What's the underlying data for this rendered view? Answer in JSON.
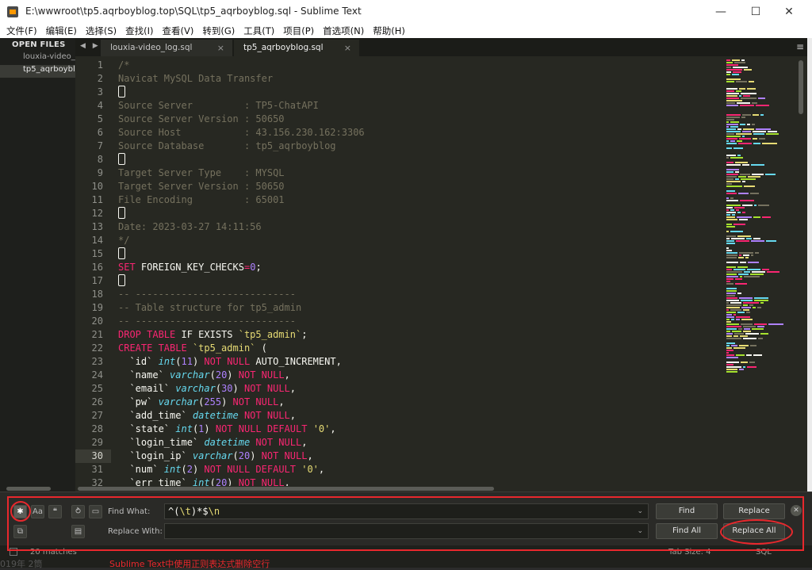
{
  "window": {
    "title": "E:\\wwwroot\\tp5.aqrboyblog.top\\SQL\\tp5_aqrboyblog.sql - Sublime Text",
    "minimize": "—",
    "maximize": "☐",
    "close": "✕"
  },
  "menu": [
    "文件(F)",
    "编辑(E)",
    "选择(S)",
    "查找(I)",
    "查看(V)",
    "转到(G)",
    "工具(T)",
    "项目(P)",
    "首选项(N)",
    "帮助(H)"
  ],
  "sidebar": {
    "header": "OPEN FILES",
    "files": [
      {
        "label": "louxia-video_"
      },
      {
        "label": "tp5_aqrboybl"
      }
    ]
  },
  "tabs": {
    "arrows": "◀ ▶",
    "items": [
      {
        "label": "louxia-video_log.sql",
        "close": "×"
      },
      {
        "label": "tp5_aqrboyblog.sql",
        "close": "×"
      }
    ],
    "menu": "≡"
  },
  "editor": {
    "current_line": 30,
    "lines": [
      {
        "n": "1",
        "segs": [
          {
            "t": "/*",
            "c": "cmt"
          }
        ]
      },
      {
        "n": "2",
        "segs": [
          {
            "t": "Navicat MySQL Data Transfer",
            "c": "cmt"
          }
        ]
      },
      {
        "n": "3",
        "segs": [],
        "blank": true
      },
      {
        "n": "4",
        "segs": [
          {
            "t": "Source Server         : TP5-ChatAPI",
            "c": "cmt"
          }
        ]
      },
      {
        "n": "5",
        "segs": [
          {
            "t": "Source Server Version : 50650",
            "c": "cmt"
          }
        ]
      },
      {
        "n": "6",
        "segs": [
          {
            "t": "Source Host           : 43.156.230.162:3306",
            "c": "cmt"
          }
        ]
      },
      {
        "n": "7",
        "segs": [
          {
            "t": "Source Database       : tp5_aqrboyblog",
            "c": "cmt"
          }
        ]
      },
      {
        "n": "8",
        "segs": [],
        "blank": true
      },
      {
        "n": "9",
        "segs": [
          {
            "t": "Target Server Type    : MYSQL",
            "c": "cmt"
          }
        ]
      },
      {
        "n": "10",
        "segs": [
          {
            "t": "Target Server Version : 50650",
            "c": "cmt"
          }
        ]
      },
      {
        "n": "11",
        "segs": [
          {
            "t": "File Encoding         : 65001",
            "c": "cmt"
          }
        ]
      },
      {
        "n": "12",
        "segs": [],
        "blank": true
      },
      {
        "n": "13",
        "segs": [
          {
            "t": "Date: 2023-03-27 14:11:56",
            "c": "cmt"
          }
        ]
      },
      {
        "n": "14",
        "segs": [
          {
            "t": "*/",
            "c": "cmt"
          }
        ]
      },
      {
        "n": "15",
        "segs": [],
        "blank": true
      },
      {
        "n": "16",
        "segs": [
          {
            "t": "SET",
            "c": "kw"
          },
          {
            "t": " FOREIGN_KEY_CHECKS",
            "c": ""
          },
          {
            "t": "=",
            "c": "kw"
          },
          {
            "t": "0",
            "c": "num"
          },
          {
            "t": ";",
            "c": ""
          }
        ]
      },
      {
        "n": "17",
        "segs": [],
        "blank": true
      },
      {
        "n": "18",
        "segs": [
          {
            "t": "-- ----------------------------",
            "c": "cmt"
          }
        ]
      },
      {
        "n": "19",
        "segs": [
          {
            "t": "-- Table structure for tp5_admin",
            "c": "cmt"
          }
        ]
      },
      {
        "n": "20",
        "segs": [
          {
            "t": "-- ----------------------------",
            "c": "cmt"
          }
        ]
      },
      {
        "n": "21",
        "segs": [
          {
            "t": "DROP TABLE",
            "c": "kw"
          },
          {
            "t": " IF EXISTS ",
            "c": ""
          },
          {
            "t": "`tp5_admin`",
            "c": "str"
          },
          {
            "t": ";",
            "c": ""
          }
        ]
      },
      {
        "n": "22",
        "segs": [
          {
            "t": "CREATE TABLE",
            "c": "kw"
          },
          {
            "t": " ",
            "c": ""
          },
          {
            "t": "`tp5_admin`",
            "c": "str"
          },
          {
            "t": " (",
            "c": ""
          }
        ]
      },
      {
        "n": "23",
        "segs": [
          {
            "t": "  `id` ",
            "c": ""
          },
          {
            "t": "int",
            "c": "ty"
          },
          {
            "t": "(",
            "c": ""
          },
          {
            "t": "11",
            "c": "num"
          },
          {
            "t": ") ",
            "c": ""
          },
          {
            "t": "NOT NULL",
            "c": "kw"
          },
          {
            "t": " AUTO_INCREMENT,",
            "c": ""
          }
        ]
      },
      {
        "n": "24",
        "segs": [
          {
            "t": "  `name` ",
            "c": ""
          },
          {
            "t": "varchar",
            "c": "ty"
          },
          {
            "t": "(",
            "c": ""
          },
          {
            "t": "20",
            "c": "num"
          },
          {
            "t": ") ",
            "c": ""
          },
          {
            "t": "NOT NULL",
            "c": "kw"
          },
          {
            "t": ",",
            "c": ""
          }
        ]
      },
      {
        "n": "25",
        "segs": [
          {
            "t": "  `email` ",
            "c": ""
          },
          {
            "t": "varchar",
            "c": "ty"
          },
          {
            "t": "(",
            "c": ""
          },
          {
            "t": "30",
            "c": "num"
          },
          {
            "t": ") ",
            "c": ""
          },
          {
            "t": "NOT NULL",
            "c": "kw"
          },
          {
            "t": ",",
            "c": ""
          }
        ]
      },
      {
        "n": "26",
        "segs": [
          {
            "t": "  `pw` ",
            "c": ""
          },
          {
            "t": "varchar",
            "c": "ty"
          },
          {
            "t": "(",
            "c": ""
          },
          {
            "t": "255",
            "c": "num"
          },
          {
            "t": ") ",
            "c": ""
          },
          {
            "t": "NOT NULL",
            "c": "kw"
          },
          {
            "t": ",",
            "c": ""
          }
        ]
      },
      {
        "n": "27",
        "segs": [
          {
            "t": "  `add_time` ",
            "c": ""
          },
          {
            "t": "datetime",
            "c": "ty"
          },
          {
            "t": " ",
            "c": ""
          },
          {
            "t": "NOT NULL",
            "c": "kw"
          },
          {
            "t": ",",
            "c": ""
          }
        ]
      },
      {
        "n": "28",
        "segs": [
          {
            "t": "  `state` ",
            "c": ""
          },
          {
            "t": "int",
            "c": "ty"
          },
          {
            "t": "(",
            "c": ""
          },
          {
            "t": "1",
            "c": "num"
          },
          {
            "t": ") ",
            "c": ""
          },
          {
            "t": "NOT NULL DEFAULT",
            "c": "kw"
          },
          {
            "t": " ",
            "c": ""
          },
          {
            "t": "'0'",
            "c": "str"
          },
          {
            "t": ",",
            "c": ""
          }
        ]
      },
      {
        "n": "29",
        "segs": [
          {
            "t": "  `login_time` ",
            "c": ""
          },
          {
            "t": "datetime",
            "c": "ty"
          },
          {
            "t": " ",
            "c": ""
          },
          {
            "t": "NOT NULL",
            "c": "kw"
          },
          {
            "t": ",",
            "c": ""
          }
        ]
      },
      {
        "n": "30",
        "segs": [
          {
            "t": "  `login_ip` ",
            "c": ""
          },
          {
            "t": "varchar",
            "c": "ty"
          },
          {
            "t": "(",
            "c": ""
          },
          {
            "t": "20",
            "c": "num"
          },
          {
            "t": ") ",
            "c": ""
          },
          {
            "t": "NOT NULL",
            "c": "kw"
          },
          {
            "t": ",",
            "c": ""
          }
        ]
      },
      {
        "n": "31",
        "segs": [
          {
            "t": "  `num` ",
            "c": ""
          },
          {
            "t": "int",
            "c": "ty"
          },
          {
            "t": "(",
            "c": ""
          },
          {
            "t": "2",
            "c": "num"
          },
          {
            "t": ") ",
            "c": ""
          },
          {
            "t": "NOT NULL DEFAULT",
            "c": "kw"
          },
          {
            "t": " ",
            "c": ""
          },
          {
            "t": "'0'",
            "c": "str"
          },
          {
            "t": ",",
            "c": ""
          }
        ]
      },
      {
        "n": "32",
        "segs": [
          {
            "t": "  `err_time` ",
            "c": ""
          },
          {
            "t": "int",
            "c": "ty"
          },
          {
            "t": "(",
            "c": ""
          },
          {
            "t": "20",
            "c": "num"
          },
          {
            "t": ") ",
            "c": ""
          },
          {
            "t": "NOT NULL",
            "c": "kw"
          },
          {
            "t": ",",
            "c": ""
          }
        ]
      }
    ]
  },
  "find": {
    "find_label": "Find What:",
    "find_value_segs": [
      {
        "t": "^(",
        "c": ""
      },
      {
        "t": "\\t",
        "c": "str"
      },
      {
        "t": ")*$",
        "c": ""
      },
      {
        "t": "\\n",
        "c": "str"
      }
    ],
    "replace_label": "Replace With:",
    "replace_value": "",
    "find_button": "Find",
    "replace_button": "Replace",
    "find_all_button": "Find All",
    "replace_all_button": "Replace All",
    "regex_icon": "✱",
    "case_icon": "Aa",
    "word_icon": "❝",
    "wrap_icon": "⥁",
    "selection_icon": "▭",
    "highlight_icon": "▤",
    "preserve_icon": "⧉",
    "dropdown": "⌄",
    "close": "✕"
  },
  "status": {
    "matches": "20 matches",
    "tab_size": "Tab Size: 4",
    "syntax": "SQL"
  },
  "background_text": {
    "bottom_text": "Sublime Text中使用正则表达式删除空行",
    "bottom_left": "019年  2筒"
  },
  "colors": {
    "annotation": "#e8282d",
    "comment": "#75715e",
    "keyword": "#f92672",
    "type": "#66d9ef",
    "number": "#ae81ff",
    "string": "#e6db74"
  }
}
